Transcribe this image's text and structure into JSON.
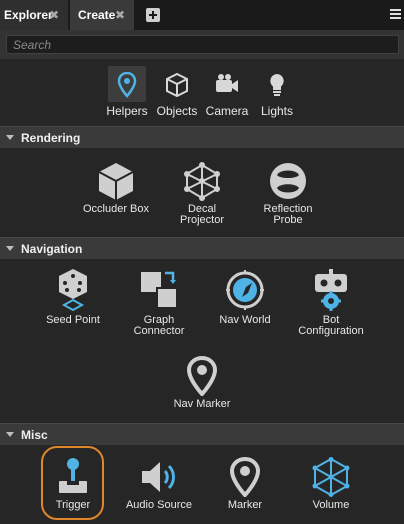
{
  "tabs": [
    {
      "label": "Explorer",
      "close": "✖"
    },
    {
      "label": "Create",
      "close": "✖"
    }
  ],
  "search": {
    "placeholder": "Search"
  },
  "categories": [
    {
      "label": "Helpers",
      "icon": "map-pin-icon",
      "active": true
    },
    {
      "label": "Objects",
      "icon": "cube-icon"
    },
    {
      "label": "Camera",
      "icon": "camera-icon"
    },
    {
      "label": "Lights",
      "icon": "lightbulb-icon"
    }
  ],
  "sections": {
    "rendering": {
      "title": "Rendering",
      "items": [
        {
          "label": "Occluder Box",
          "icon": "cube-icon"
        },
        {
          "label": "Decal\nProjector",
          "icon": "projector-icon"
        },
        {
          "label": "Reflection\nProbe",
          "icon": "probe-icon"
        }
      ]
    },
    "navigation": {
      "title": "Navigation",
      "items": [
        {
          "label": "Seed Point",
          "icon": "dice-icon"
        },
        {
          "label": "Graph\nConnector",
          "icon": "graph-connector-icon"
        },
        {
          "label": "Nav World",
          "icon": "compass-icon"
        },
        {
          "label": "Bot\nConfiguration",
          "icon": "robot-icon"
        },
        {
          "label": "Nav Marker",
          "icon": "map-pin-icon"
        }
      ]
    },
    "misc": {
      "title": "Misc",
      "items": [
        {
          "label": "Trigger",
          "icon": "joystick-icon",
          "selected": true
        },
        {
          "label": "Audio Source",
          "icon": "speaker-icon"
        },
        {
          "label": "Marker",
          "icon": "map-pin-icon"
        },
        {
          "label": "Volume",
          "icon": "volume-icon"
        }
      ]
    }
  },
  "colors": {
    "accent": "#4fb3e6",
    "selection": "#e0862b",
    "background": "#262626"
  }
}
